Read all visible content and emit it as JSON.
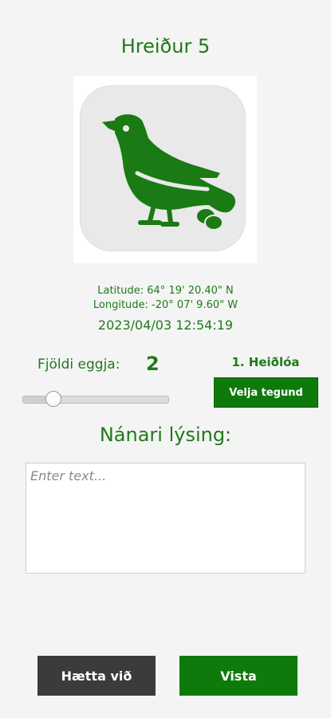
{
  "header": {
    "title": "Hreiður 5"
  },
  "image": {
    "icon": "bird-icon",
    "colors": {
      "bird": "#1a7a14",
      "background": "#e9e9e9"
    }
  },
  "location": {
    "latitude": "Latitude: 64° 19' 20.40\" N",
    "longitude": "Longitude: -20° 07' 9.60\" W",
    "datetime": "2023/04/03 12:54:19"
  },
  "eggs": {
    "label": "Fjöldi eggja:",
    "count": "2",
    "slider_fraction": 0.21
  },
  "species": {
    "selected": "1. Heiðlóa",
    "choose_label": "Velja tegund"
  },
  "description": {
    "title": "Nánari lýsing:",
    "placeholder": "Enter text...",
    "value": ""
  },
  "actions": {
    "cancel_label": "Hætta við",
    "save_label": "Vista"
  },
  "colors": {
    "accent": "#1f7a1a",
    "primary_button": "#0f7a0c",
    "secondary_button": "#3b3b3b",
    "background": "#f4f4f4"
  }
}
